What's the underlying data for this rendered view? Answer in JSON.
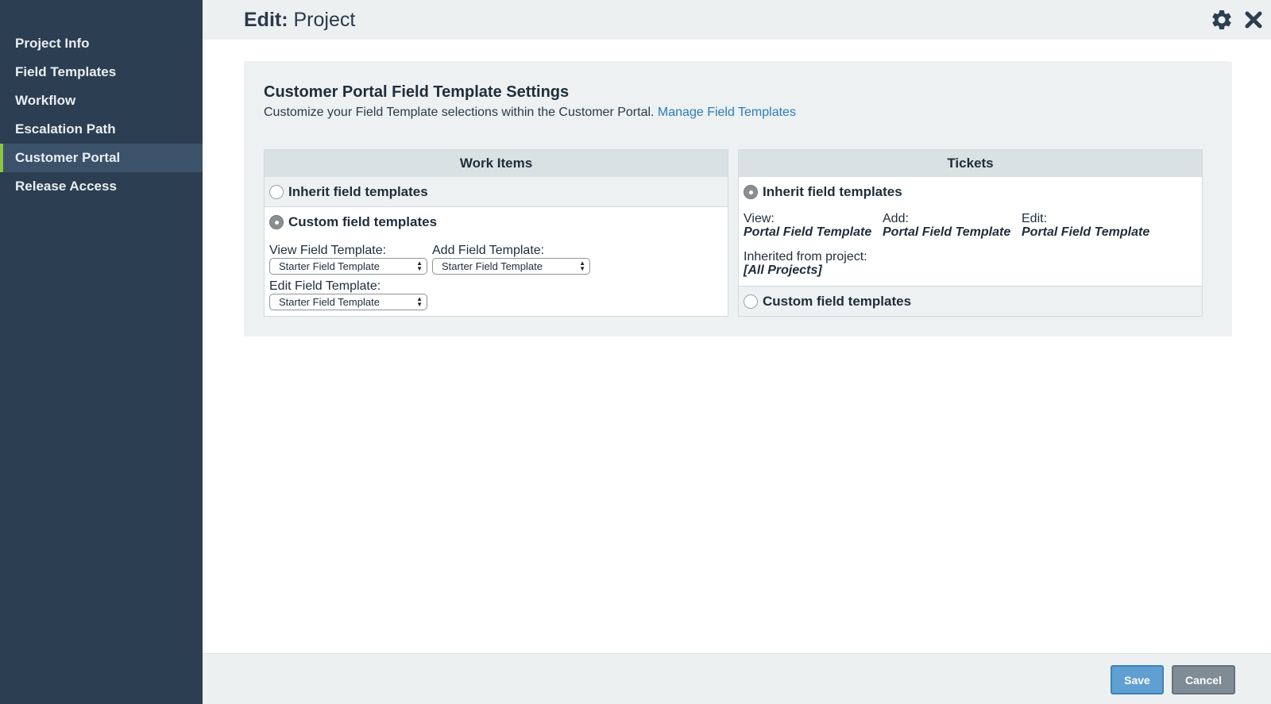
{
  "sidebar": {
    "items": [
      {
        "label": "Project Info"
      },
      {
        "label": "Field Templates"
      },
      {
        "label": "Workflow"
      },
      {
        "label": "Escalation Path"
      },
      {
        "label": "Customer Portal"
      },
      {
        "label": "Release Access"
      }
    ],
    "active_index": 4
  },
  "header": {
    "title_prefix": "Edit:",
    "title_name": "Project",
    "icons": [
      "gear-icon",
      "close-icon"
    ]
  },
  "panel": {
    "title": "Customer Portal Field Template Settings",
    "subtitle": "Customize your Field Template selections within the Customer Portal.",
    "link_label": "Manage Field Templates"
  },
  "work_items": {
    "heading": "Work Items",
    "inherit_label": "Inherit field templates",
    "custom_label": "Custom field templates",
    "selected": "custom",
    "view_label": "View Field Template:",
    "view_value": "Starter Field Template",
    "add_label": "Add Field Template:",
    "add_value": "Starter Field Template",
    "edit_label": "Edit Field Template:",
    "edit_value": "Starter Field Template"
  },
  "tickets": {
    "heading": "Tickets",
    "inherit_label": "Inherit field templates",
    "custom_label": "Custom field templates",
    "selected": "inherit",
    "view_label": "View:",
    "view_value": "Portal Field Template",
    "add_label": "Add:",
    "add_value": "Portal Field Template",
    "edit_label": "Edit:",
    "edit_value": "Portal Field Template",
    "inherited_from_label": "Inherited from project:",
    "inherited_from_value": "[All Projects]"
  },
  "footer": {
    "save_label": "Save",
    "cancel_label": "Cancel"
  },
  "colors": {
    "sidebar_bg": "#2c3e51",
    "active_accent": "#8cc63f",
    "link": "#2b7bb9",
    "save_button": "#5f9fd1",
    "cancel_button": "#7f8c96"
  }
}
